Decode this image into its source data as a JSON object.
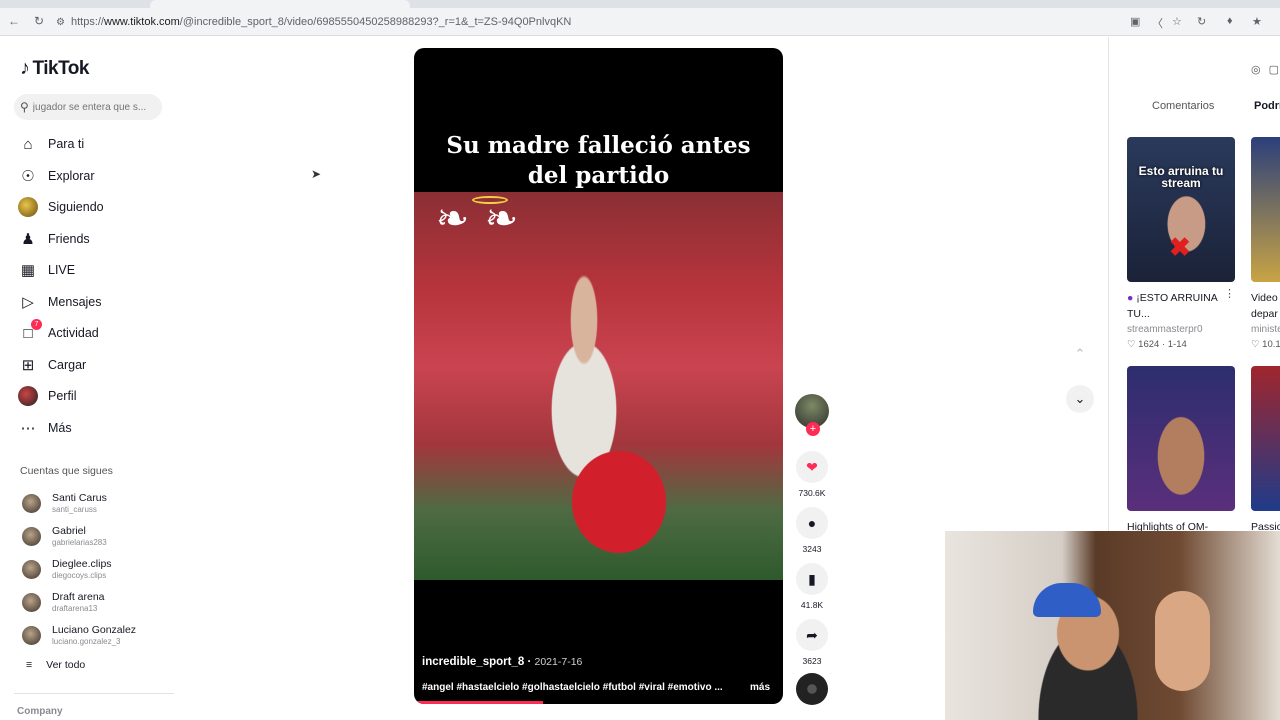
{
  "browser": {
    "url_prefix": "https://",
    "url_host": "www.tiktok.com",
    "url_path": "/@incredible_sport_8/video/6985550450258988293?_r=1&_t=ZS-94Q0PnlvqKN"
  },
  "sidebar": {
    "logo": "TikTok",
    "search_placeholder": "jugador se entera que s...",
    "nav": [
      {
        "label": "Para ti",
        "icon": "home-icon"
      },
      {
        "label": "Explorar",
        "icon": "compass-icon"
      },
      {
        "label": "Siguiendo",
        "icon": "avatar"
      },
      {
        "label": "Friends",
        "icon": "friends-icon"
      },
      {
        "label": "LIVE",
        "icon": "live-icon"
      },
      {
        "label": "Mensajes",
        "icon": "paper-plane-icon"
      },
      {
        "label": "Actividad",
        "icon": "inbox-icon",
        "badge": "7"
      },
      {
        "label": "Cargar",
        "icon": "plus-square-icon"
      },
      {
        "label": "Perfil",
        "icon": "avatar"
      },
      {
        "label": "Más",
        "icon": "dots-icon"
      }
    ],
    "following_title": "Cuentas que sigues",
    "following": [
      {
        "name": "Santi Carus",
        "handle": "santi_caruss"
      },
      {
        "name": "Gabriel",
        "handle": "gabrielarias283"
      },
      {
        "name": "Dieglee.clips",
        "handle": "diegocoys.clips"
      },
      {
        "name": "Draft arena",
        "handle": "draftarena13"
      },
      {
        "name": "Luciano Gonzalez",
        "handle": "luciano.gonzalez_3"
      }
    ],
    "see_all": "Ver todo",
    "company": "Company"
  },
  "video": {
    "caption_line1": "Su madre falleció antes",
    "caption_line2": "del partido",
    "author": "incredible_sport_8",
    "date": "2021-7-16",
    "hashtags": "#angel #hastaelcielo #golhastaelcielo #futbol #viral #emotivo ...",
    "more": "más",
    "progress": 0.35
  },
  "actions": {
    "likes": "730.6K",
    "comments": "3243",
    "saves": "41.8K",
    "shares": "3623"
  },
  "right_panel": {
    "tabs": [
      "Comentarios",
      "Podrí"
    ],
    "cards": [
      {
        "thumb_text": "Esto arruina tu stream",
        "title": "¡ESTO ARRUINA TU...",
        "user": "streammasterpr0",
        "likes": "1624",
        "date": "1-14"
      },
      {
        "title": "Video depar",
        "user": "ministe",
        "likes": "10.1"
      },
      {
        "title": "Highlights of OM-",
        "user": "",
        "likes": ""
      },
      {
        "title": "Passio",
        "user": "",
        "likes": ""
      }
    ]
  },
  "colors": {
    "accent": "#fe2c55"
  }
}
